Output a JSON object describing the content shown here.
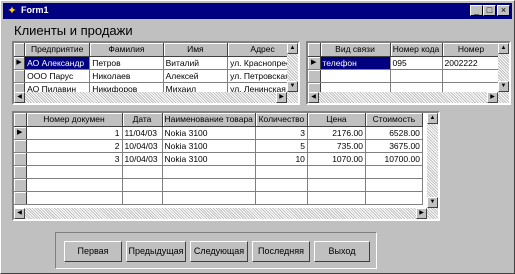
{
  "window": {
    "title": "Form1",
    "min_label": "_",
    "max_label": "□",
    "close_label": "×"
  },
  "section_title": "Клиенты и продажи",
  "clients_grid": {
    "columns": [
      "Предприятие",
      "Фамилия",
      "Имя",
      "Адрес"
    ],
    "rows": [
      [
        "АО Александр",
        "Петров",
        "Виталий",
        "ул. Краснопресн"
      ],
      [
        "ООО Парус",
        "Николаев",
        "Алексей",
        "ул. Петровская"
      ],
      [
        "АО Пилавин",
        "Никифоров",
        "Михаил",
        "ул. Ленинская"
      ]
    ]
  },
  "phones_grid": {
    "columns": [
      "Вид связи",
      "Номер кода",
      "Номер"
    ],
    "rows": [
      [
        "телефон",
        "095",
        "2002222"
      ]
    ]
  },
  "sales_grid": {
    "columns": [
      "Номер докумен",
      "Дата",
      "Наименование товара",
      "Количество",
      "Цена",
      "Стоимость"
    ],
    "rows": [
      [
        "1",
        "11/04/03",
        "Nokia 3100",
        "3",
        "2176.00",
        "6528.00"
      ],
      [
        "2",
        "10/04/03",
        "Nokia 3100",
        "5",
        "735.00",
        "3675.00"
      ],
      [
        "3",
        "10/04/03",
        "Nokia 3100",
        "10",
        "1070.00",
        "10700.00"
      ]
    ]
  },
  "buttons": [
    "Первая",
    "Предыдущая",
    "Следующая",
    "Последняя",
    "Выход"
  ],
  "icons": {
    "app": "form-icon",
    "row_indicator": "triangle-right-icon"
  },
  "colors": {
    "face": "#c0c0c0",
    "titlebar": "#000080",
    "selection": "#000080"
  }
}
